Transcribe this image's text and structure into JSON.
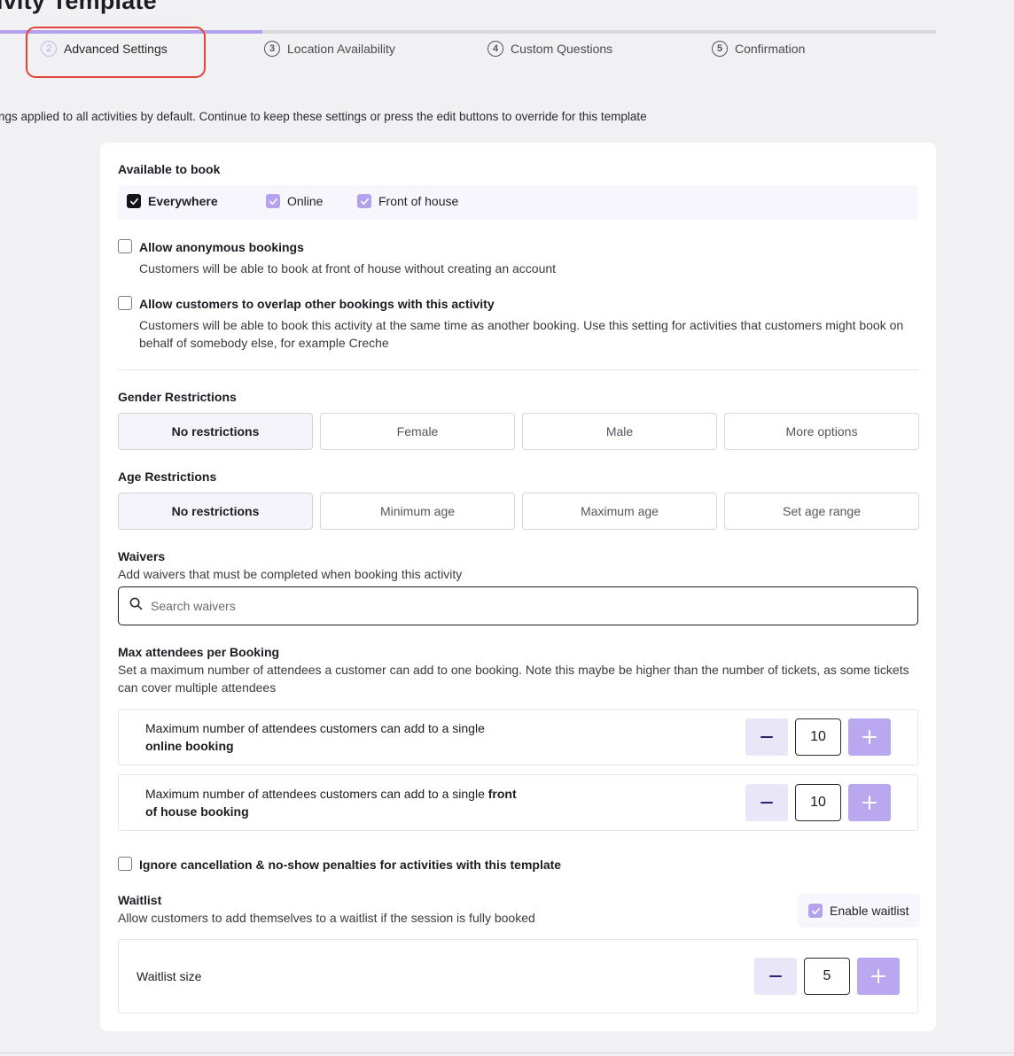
{
  "page": {
    "title": "ivity Template",
    "intro": "ngs applied to all activities by default. Continue to keep these settings or press the edit buttons to override for this template"
  },
  "progress": {
    "fraction": 0.28
  },
  "steps": [
    {
      "num": "2",
      "label": "Advanced Settings",
      "active": true
    },
    {
      "num": "3",
      "label": "Location Availability",
      "active": false
    },
    {
      "num": "4",
      "label": "Custom Questions",
      "active": false
    },
    {
      "num": "5",
      "label": "Confirmation",
      "active": false
    }
  ],
  "available": {
    "heading": "Available to book",
    "everywhere": "Everywhere",
    "online": "Online",
    "front_of_house": "Front of house"
  },
  "anonymous": {
    "label": "Allow anonymous bookings",
    "desc": "Customers will be able to book at front of house without creating an account",
    "checked": false
  },
  "overlap": {
    "label": "Allow customers to overlap other bookings with this activity",
    "desc": "Customers will be able to book this activity at the same time as another booking. Use this setting for activities that customers might book on behalf of somebody else, for example Creche",
    "checked": false
  },
  "gender": {
    "heading": "Gender Restrictions",
    "options": [
      "No restrictions",
      "Female",
      "Male",
      "More options"
    ],
    "selected": "No restrictions"
  },
  "age": {
    "heading": "Age Restrictions",
    "options": [
      "No restrictions",
      "Minimum age",
      "Maximum age",
      "Set age range"
    ],
    "selected": "No restrictions"
  },
  "waivers": {
    "heading": "Waivers",
    "desc": "Add waivers that must be completed when booking this activity",
    "placeholder": "Search waivers"
  },
  "attendees": {
    "heading": "Max attendees per Booking",
    "desc": "Set a maximum number of attendees a customer can add to one booking. Note this maybe be higher than the number of tickets, as some tickets can cover multiple attendees",
    "online_text": "Maximum number of attendees customers can add to a single",
    "online_bold": "online booking",
    "online_value": "10",
    "foh_text": "Maximum number of attendees customers can add to a single",
    "foh_bold_a": "front",
    "foh_bold_b": "of house booking",
    "foh_value": "10"
  },
  "penalties": {
    "label": "Ignore cancellation & no-show penalties for activities with this template",
    "checked": false
  },
  "waitlist": {
    "heading": "Waitlist",
    "desc": "Allow customers to add themselves to a waitlist if the session is fully booked",
    "enable_label": "Enable waitlist",
    "size_label": "Waitlist size",
    "size_value": "5"
  },
  "colors": {
    "accent": "#b9a8f0",
    "accent_light": "#e9e6f7",
    "highlight_ring": "#e0453a"
  },
  "icons": {
    "check": "check-icon",
    "search": "search-icon",
    "minus": "minus-icon",
    "plus": "plus-icon"
  }
}
